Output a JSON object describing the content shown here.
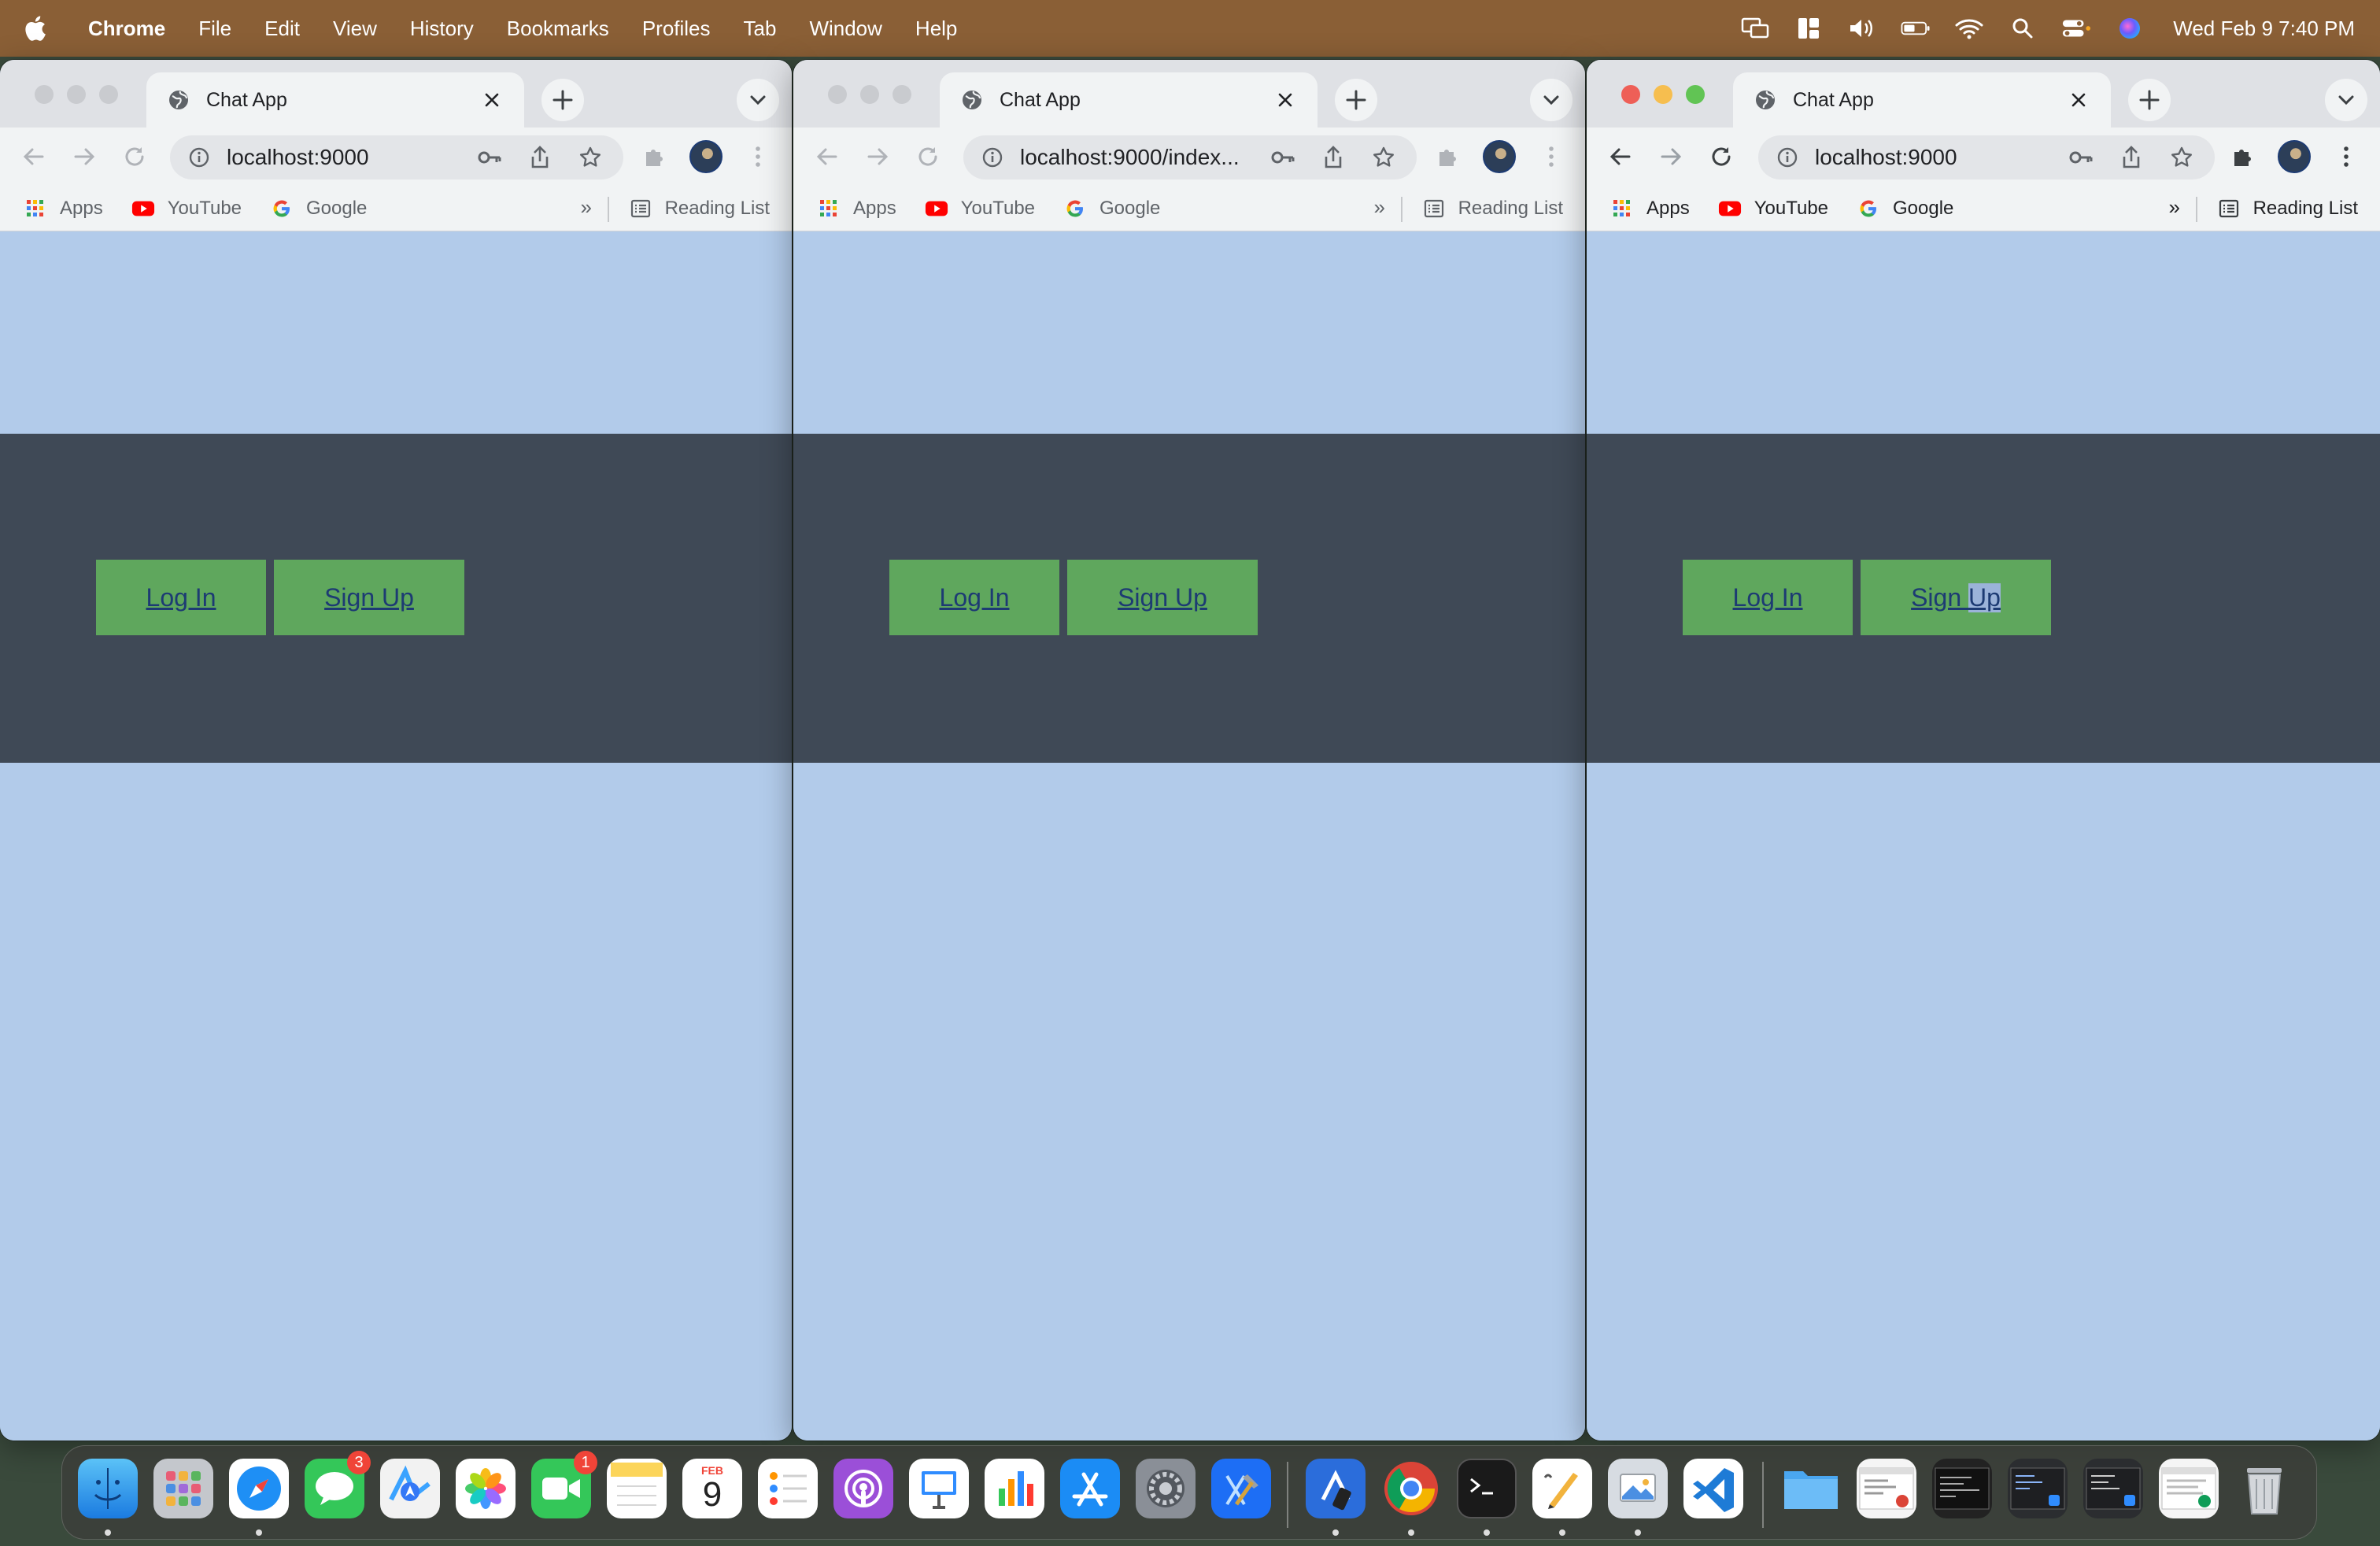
{
  "menubar": {
    "app_name": "Chrome",
    "items": [
      "File",
      "Edit",
      "View",
      "History",
      "Bookmarks",
      "Profiles",
      "Tab",
      "Window",
      "Help"
    ],
    "clock": "Wed Feb 9  7:40 PM"
  },
  "windows": [
    {
      "tab_title": "Chat App",
      "url": "localhost:9000",
      "bookmarks": [
        "Apps",
        "YouTube",
        "Google"
      ],
      "reading_list": "Reading List",
      "buttons": {
        "login": "Log In",
        "signup": "Sign Up"
      }
    },
    {
      "tab_title": "Chat App",
      "url": "localhost:9000/index...",
      "bookmarks": [
        "Apps",
        "YouTube",
        "Google"
      ],
      "reading_list": "Reading List",
      "buttons": {
        "login": "Log In",
        "signup": "Sign Up"
      }
    },
    {
      "tab_title": "Chat App",
      "url": "localhost:9000",
      "bookmarks": [
        "Apps",
        "YouTube",
        "Google"
      ],
      "reading_list": "Reading List",
      "buttons": {
        "login": "Log In",
        "signup_a": "Sign ",
        "signup_b": "Up"
      }
    }
  ],
  "bookmarks_more": "»",
  "dock": {
    "messages_badge": "3",
    "facetime_badge": "1",
    "calendar_month": "FEB",
    "calendar_day": "9"
  },
  "colors": {
    "menubar": "#8a5f36",
    "page_bg": "#b2cbea",
    "header_band": "#3f4956",
    "button_bg": "#5fa75d",
    "link": "#1d3b73"
  }
}
